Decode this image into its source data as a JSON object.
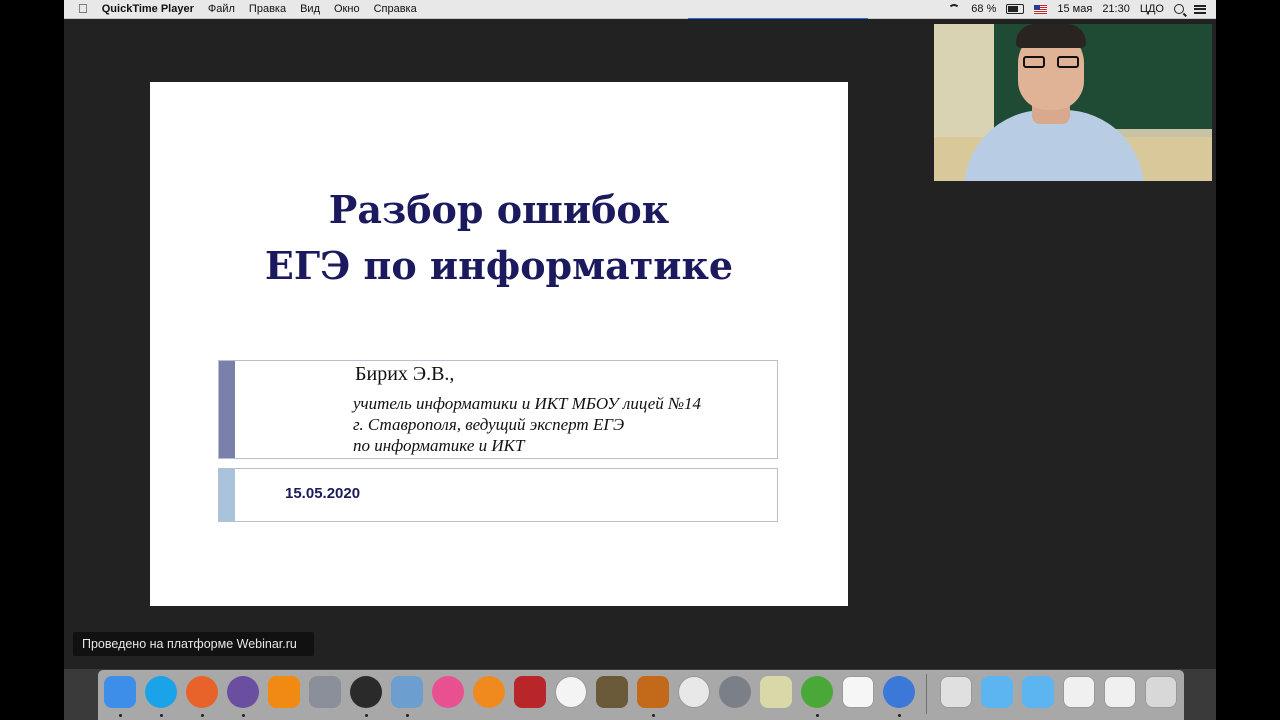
{
  "menubar": {
    "app_name": "QuickTime Player",
    "menus": [
      "Файл",
      "Правка",
      "Вид",
      "Окно",
      "Справка"
    ],
    "battery_percent": "68 %",
    "battery_level": 0.68,
    "date": "15 мая",
    "time": "21:30",
    "user": "ЦДО"
  },
  "slide": {
    "title_line1": "Разбор ошибок",
    "title_line2": "ЕГЭ по информатике",
    "author": "Бирих Э.В.,",
    "desc_line1": "учитель информатики и ИКТ МБОУ лицей №14",
    "desc_line2": "г. Ставрополя, ведущий эксперт ЕГЭ",
    "desc_line3": "по информатике и ИКТ",
    "date": "15.05.2020"
  },
  "webinar_tag": "Проведено на платформе Webinar.ru",
  "dock": {
    "apps": [
      {
        "name": "finder-icon",
        "color": "#3d8ee8"
      },
      {
        "name": "skype-icon",
        "color": "#1aa3e8"
      },
      {
        "name": "firefox-icon",
        "color": "#e8632a"
      },
      {
        "name": "game-icon",
        "color": "#6a4fa0"
      },
      {
        "name": "vlc-icon",
        "color": "#f08a12"
      },
      {
        "name": "launchpad-icon",
        "color": "#8a8f99"
      },
      {
        "name": "dashboard-icon",
        "color": "#2a2a2a"
      },
      {
        "name": "preview-icon",
        "color": "#6d9ed0"
      },
      {
        "name": "itunes-icon",
        "color": "#e8508f"
      },
      {
        "name": "ibooks-icon",
        "color": "#f08a1e"
      },
      {
        "name": "photo-booth-icon",
        "color": "#b8262a"
      },
      {
        "name": "photos-icon",
        "color": "#f4f4f4"
      },
      {
        "name": "imovie-icon",
        "color": "#6b5a3a"
      },
      {
        "name": "garageband-icon",
        "color": "#c26a1a"
      },
      {
        "name": "cursor-icon",
        "color": "#e8e8e8"
      },
      {
        "name": "system-preferences-icon",
        "color": "#7a7f88"
      },
      {
        "name": "script-icon",
        "color": "#d8d8a8"
      },
      {
        "name": "utorrent-icon",
        "color": "#4aa838"
      },
      {
        "name": "document-icon",
        "color": "#f6f6f6"
      },
      {
        "name": "quicktime-icon",
        "color": "#3b78d8"
      },
      {
        "name": "screenshot-thumb-icon",
        "color": "#e0e0e0"
      },
      {
        "name": "applications-folder-icon",
        "color": "#5cb4f0"
      },
      {
        "name": "documents-folder-icon",
        "color": "#5cb4f0"
      },
      {
        "name": "downloads-thumb-icon",
        "color": "#f0f0f0"
      },
      {
        "name": "screen-thumb-icon",
        "color": "#f0f0f0"
      },
      {
        "name": "trash-icon",
        "color": "#d8d8d8"
      }
    ]
  }
}
